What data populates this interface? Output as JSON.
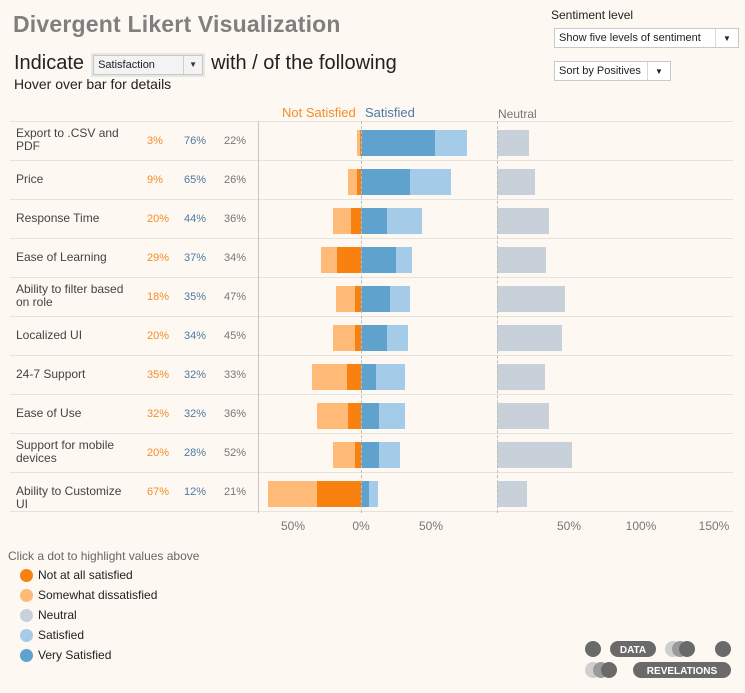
{
  "header": {
    "title": "Divergent Likert Visualization",
    "indicate_prefix": "Indicate",
    "indicate_select": "Satisfaction",
    "indicate_suffix": "with / of the following",
    "hover_hint": "Hover over bar for details"
  },
  "controls": {
    "sentiment_label": "Sentiment level",
    "sentiment_value": "Show five levels of sentiment",
    "sort_value": "Sort by Positives"
  },
  "columns": {
    "not_satisfied": "Not Satisfied",
    "satisfied": "Satisfied",
    "neutral": "Neutral"
  },
  "colors": {
    "not_at_all": "#f8810f",
    "somewhat_dis": "#ffba78",
    "neutral": "#c8d0da",
    "satisfied": "#a4cbe8",
    "very_satisfied": "#5fa2ce",
    "neg_text": "#f28e2b",
    "pos_text": "#4e79a7"
  },
  "chart_data": {
    "type": "bar",
    "subtype": "diverging-stacked",
    "categories": [
      "Export to .CSV and PDF",
      "Price",
      "Response Time",
      "Ease of Learning",
      "Ability to filter based on role",
      "Localized UI",
      "24-7 Support",
      "Ease of Use",
      "Support for mobile devices",
      "Ability to Customize UI"
    ],
    "series": [
      {
        "name": "Not at all satisfied",
        "values": [
          1,
          3,
          7,
          17,
          4,
          4,
          10,
          9,
          4,
          32
        ]
      },
      {
        "name": "Somewhat dissatisfied",
        "values": [
          2,
          6,
          13,
          12,
          14,
          16,
          25,
          23,
          16,
          35
        ]
      },
      {
        "name": "Neutral",
        "values": [
          22,
          26,
          36,
          34,
          47,
          45,
          33,
          36,
          52,
          21
        ]
      },
      {
        "name": "Satisfied",
        "values": [
          23,
          30,
          25,
          12,
          14,
          15,
          21,
          19,
          15,
          6
        ]
      },
      {
        "name": "Very Satisfied",
        "values": [
          53,
          35,
          19,
          25,
          21,
          19,
          11,
          13,
          13,
          6
        ]
      }
    ],
    "totals": {
      "negative": [
        "3%",
        "9%",
        "20%",
        "29%",
        "18%",
        "20%",
        "35%",
        "32%",
        "20%",
        "67%"
      ],
      "positive": [
        "76%",
        "65%",
        "44%",
        "37%",
        "35%",
        "34%",
        "32%",
        "32%",
        "28%",
        "12%"
      ],
      "neutral": [
        "22%",
        "26%",
        "36%",
        "34%",
        "47%",
        "45%",
        "33%",
        "36%",
        "52%",
        "21%"
      ]
    },
    "diverging_axis": {
      "ticks": [
        "50%",
        "0%",
        "50%"
      ],
      "range": [
        -75,
        80
      ]
    },
    "neutral_axis": {
      "ticks": [
        "50%",
        "100%",
        "150%"
      ],
      "range": [
        0,
        160
      ]
    },
    "legend": {
      "hint": "Click a dot to highlight values above",
      "items": [
        "Not at all satisfied",
        "Somewhat dissatisfied",
        "Neutral",
        "Satisfied",
        "Very Satisfied"
      ],
      "position": "bottom-left"
    }
  },
  "logo": {
    "top": "DATA",
    "bottom": "REVELATIONS"
  }
}
